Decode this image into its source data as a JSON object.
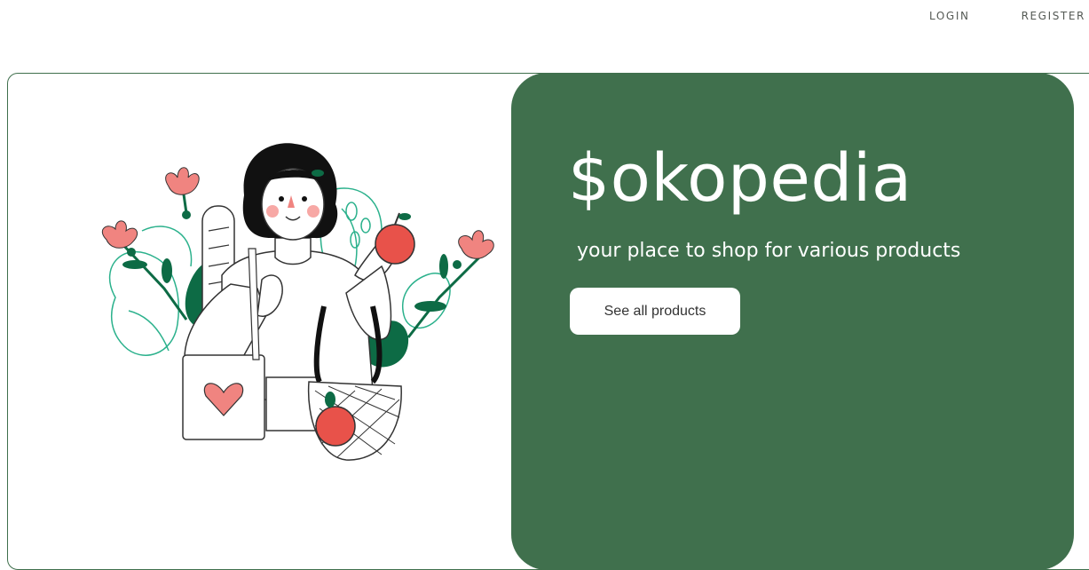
{
  "nav": {
    "login_label": "LOGIN",
    "register_label": "REGISTER"
  },
  "hero": {
    "brand": "$okopedia",
    "tagline": "your place to shop for various products",
    "cta_label": "See all products",
    "illustration": "woman-shopping-illustration",
    "colors": {
      "panel": "#40704d",
      "card_border": "#3f6f4c",
      "button_bg": "#ffffff",
      "text_light": "#ffffff"
    }
  }
}
